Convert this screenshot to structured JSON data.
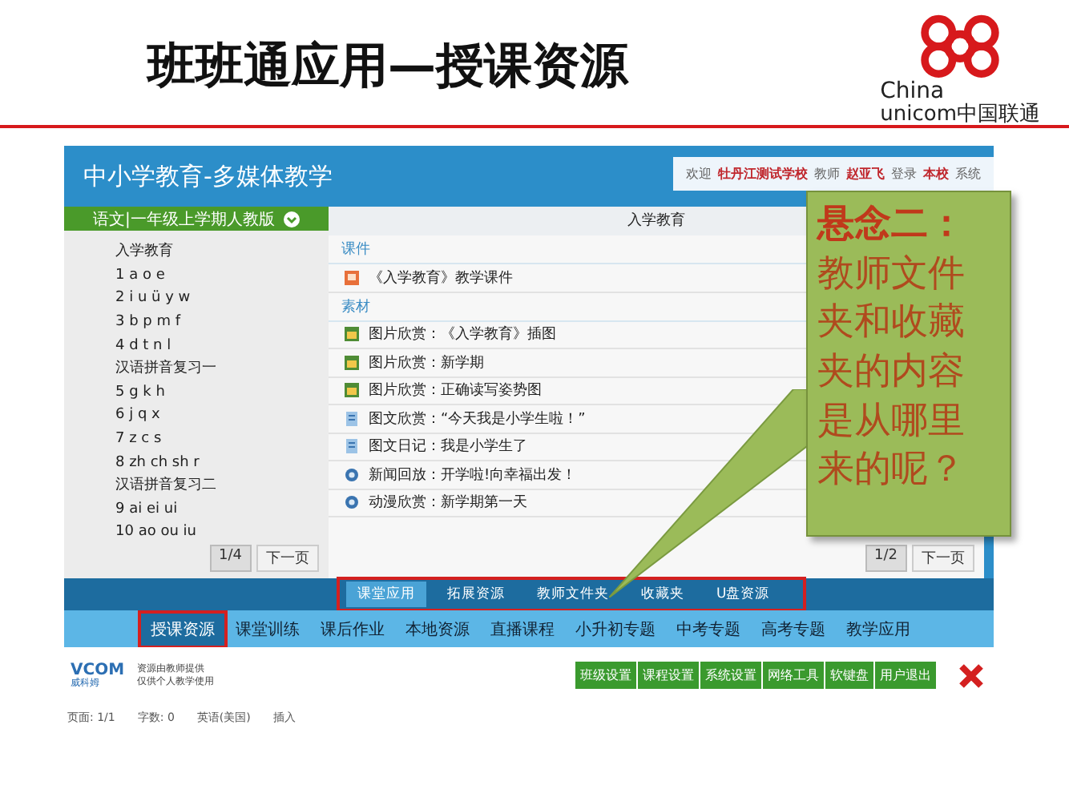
{
  "slide": {
    "title": "班班通应用—授课资源",
    "logo": {
      "line1": "China",
      "line2": "unicom中国联通"
    }
  },
  "app": {
    "title": "中小学教育-多媒体教学",
    "welcome": [
      {
        "text": "欢迎",
        "highlight": false
      },
      {
        "text": "牡丹江测试学校",
        "highlight": true
      },
      {
        "text": "教师",
        "highlight": false
      },
      {
        "text": "赵亚飞",
        "highlight": true
      },
      {
        "text": "登录",
        "highlight": false
      },
      {
        "text": "本校",
        "highlight": true
      },
      {
        "text": "系统",
        "highlight": false
      }
    ]
  },
  "left_panel": {
    "header": "语文|一年级上学期人教版",
    "items": [
      "入学教育",
      "1 a o e",
      "2 i u ü y w",
      "3 b p m f",
      "4 d t n l",
      "汉语拼音复习一",
      "5 g k h",
      "6 j q x",
      "7 z c s",
      "8 zh ch sh r",
      "汉语拼音复习二",
      "9 ai ei ui",
      "10 ao ou iu"
    ],
    "page": "1/4",
    "next": "下一页"
  },
  "right_panel": {
    "header": "入学教育",
    "sections": [
      {
        "title": "课件",
        "items": [
          {
            "kind": "courseware",
            "text": "《入学教育》教学课件"
          }
        ]
      },
      {
        "title": "素材",
        "items": [
          {
            "kind": "image",
            "text": "图片欣赏：《入学教育》插图"
          },
          {
            "kind": "image",
            "text": "图片欣赏：新学期"
          },
          {
            "kind": "image",
            "text": "图片欣赏：正确读写姿势图"
          },
          {
            "kind": "article",
            "text": "图文欣赏：“今天我是小学生啦！”"
          },
          {
            "kind": "article",
            "text": "图文日记：我是小学生了"
          },
          {
            "kind": "video",
            "text": "新闻回放：开学啦!向幸福出发！"
          },
          {
            "kind": "video",
            "text": "动漫欣赏：新学期第一天"
          }
        ]
      }
    ],
    "page": "1/2",
    "next": "下一页"
  },
  "tabs": {
    "highlighted": true,
    "items": [
      {
        "label": "课堂应用",
        "selected": true
      },
      {
        "label": "拓展资源",
        "selected": false
      },
      {
        "label": "教师文件夹",
        "selected": false
      },
      {
        "label": "收藏夹",
        "selected": false
      },
      {
        "label": "U盘资源",
        "selected": false
      }
    ]
  },
  "nav": [
    {
      "label": "授课资源",
      "selected": true,
      "highlighted": true
    },
    {
      "label": "课堂训练",
      "selected": false,
      "highlighted": false
    },
    {
      "label": "课后作业",
      "selected": false,
      "highlighted": false
    },
    {
      "label": "本地资源",
      "selected": false,
      "highlighted": false
    },
    {
      "label": "直播课程",
      "selected": false,
      "highlighted": false
    },
    {
      "label": "小升初专题",
      "selected": false,
      "highlighted": false
    },
    {
      "label": "中考专题",
      "selected": false,
      "highlighted": false
    },
    {
      "label": "高考专题",
      "selected": false,
      "highlighted": false
    },
    {
      "label": "教学应用",
      "selected": false,
      "highlighted": false
    }
  ],
  "footer": {
    "brand": "VCOM",
    "brand_sub": "威科姆",
    "notice": [
      "资源由教师提供",
      "仅供个人教学使用"
    ],
    "buttons": [
      "班级设置",
      "课程设置",
      "系统设置",
      "网络工具",
      "软键盘",
      "用户退出"
    ]
  },
  "status_bar": [
    "页面: 1/1",
    "字数: 0",
    "英语(美国)",
    "插入"
  ],
  "callout": {
    "heading": "悬念二：",
    "body": "教师文件夹和收藏夹的内容是从哪里来的呢？"
  }
}
